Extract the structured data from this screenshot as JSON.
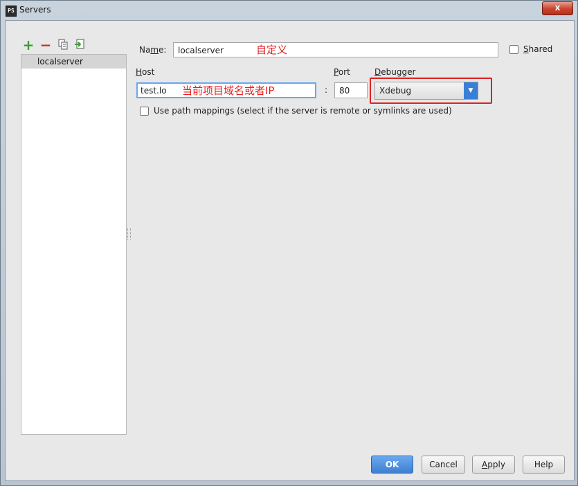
{
  "window": {
    "title": "Servers",
    "close_label": "x"
  },
  "toolbar": {
    "add": "+",
    "remove": "−"
  },
  "server_list": {
    "items": [
      {
        "label": "localserver"
      }
    ]
  },
  "form": {
    "name_label_pre": "Na",
    "name_label_ul": "m",
    "name_label_post": "e:",
    "name_value": "localserver",
    "name_annotation": "自定义",
    "shared_label": "Shared",
    "host_label": "Host",
    "host_value": "test.lo",
    "host_annotation": "当前项目域名或者IP",
    "port_label": "Port",
    "port_separator": ":",
    "port_value": "80",
    "debugger_label": "Debugger",
    "debugger_value": "Xdebug",
    "debugger_arrow": "▼",
    "path_mappings_label": "Use path mappings (select if the server is remote or symlinks are used)"
  },
  "buttons": {
    "ok": "OK",
    "cancel": "Cancel",
    "apply": "Apply",
    "help": "Help"
  },
  "colors": {
    "accent": "#3f7fd1",
    "annotation": "#e62020",
    "add": "#3d9b32",
    "remove": "#c9321f"
  }
}
